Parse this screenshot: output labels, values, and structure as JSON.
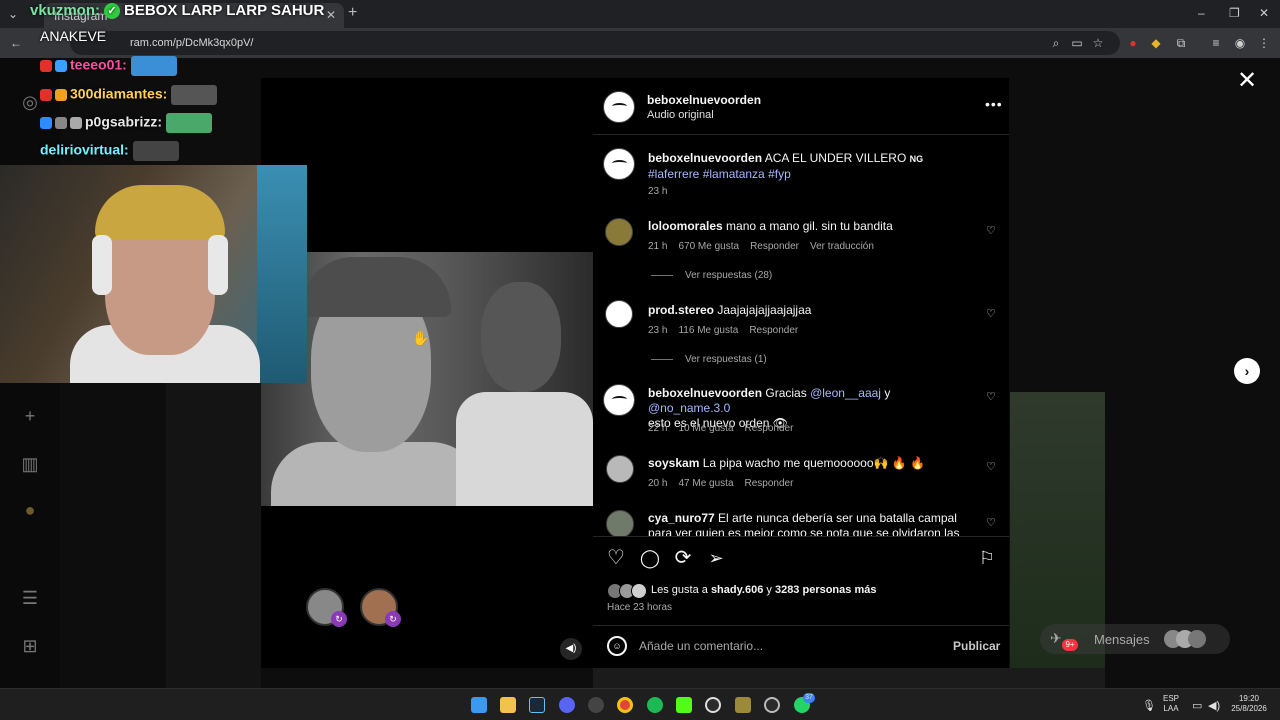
{
  "browser": {
    "tab_title": "Instagram",
    "url": "ram.com/p/DcMk3qx0pV/",
    "win_minimize": "–",
    "win_restore": "❐",
    "win_close": "✕"
  },
  "overlay": {
    "user": "vkuzmon:",
    "title": "BEBOX LARP LARP SAHUR",
    "subtitle": "ANAKEVE",
    "chat": [
      {
        "name": "teeeo01:",
        "color": "#ff4fa3"
      },
      {
        "name": "300diamantes:",
        "color": "#ffd24a"
      },
      {
        "name": "p0gsabrizz:",
        "color": "#e8e8e8"
      },
      {
        "name": "deliriovirtual:",
        "color": "#6ef3ff"
      }
    ]
  },
  "post": {
    "username": "beboxelnuevoorden",
    "audio": "Audio original",
    "more": "•••",
    "caption": {
      "user": "beboxelnuevoorden",
      "text": "ACA EL UNDER VILLERO",
      "ng": "NG",
      "tags": "#laferrere #lamatanza #fyp",
      "time": "23 h"
    },
    "comments": [
      {
        "user": "loloomorales",
        "text": "mano a mano gil. sin tu bandita",
        "time": "21 h",
        "likes": "670 Me gusta",
        "reply": "Responder",
        "translate": "Ver traducción",
        "replies": "Ver respuestas (28)"
      },
      {
        "user": "prod.stereo",
        "text": "Jaajajajajjaajajjaa",
        "time": "23 h",
        "likes": "116 Me gusta",
        "reply": "Responder",
        "replies": "Ver respuestas (1)"
      },
      {
        "user": "beboxelnuevoorden",
        "text_a": "Gracias",
        "mention1": "@leon__aaaj",
        "text_b": "y",
        "mention2": "@no_name.3.0",
        "text_c": "esto es el nuevo orden 👁",
        "time": "22 h",
        "likes": "10 Me gusta",
        "reply": "Responder"
      },
      {
        "user": "soyskam",
        "text": "La pipa wacho me quemoooooo🙌 🔥 🔥",
        "time": "20 h",
        "likes": "47 Me gusta",
        "reply": "Responder"
      },
      {
        "user": "cya_nuro77",
        "text": "El arte nunca debería ser una batalla campal para ver quien es mejor como se nota que se olvidaron las raíces"
      }
    ],
    "likes_prefix": "Les gusta a",
    "likes_user": "shady.606",
    "likes_mid": "y",
    "likes_count": "3283 personas más",
    "posted_ago": "Hace 23 horas",
    "comment_placeholder": "Añade un comentario...",
    "publish": "Publicar"
  },
  "messages": {
    "label": "Mensajes",
    "badge": "9+"
  },
  "taskbar": {
    "lang1": "ESP",
    "lang2": "LAA",
    "time": "19:20",
    "date": "25/8/2026",
    "whatsapp_badge": "37"
  },
  "colors": {
    "accent_link": "#a7b8ff",
    "notification": "#ff3040"
  }
}
